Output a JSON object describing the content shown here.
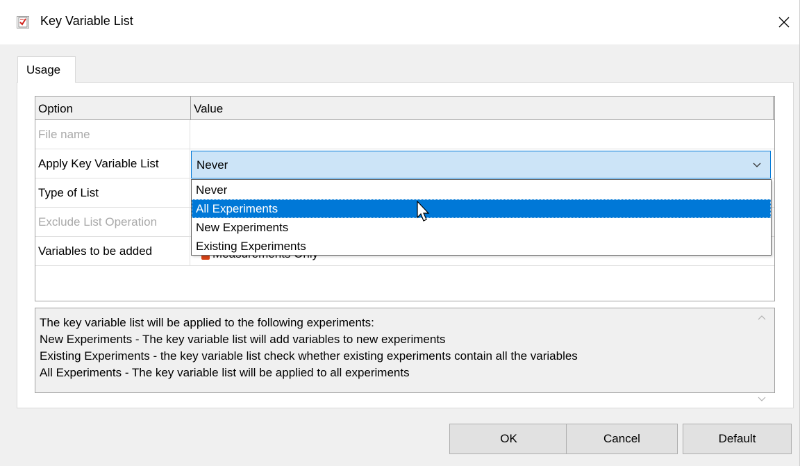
{
  "window": {
    "title": "Key Variable List",
    "close_glyph": "✕"
  },
  "tabs": [
    {
      "label": "Usage",
      "selected": true
    }
  ],
  "grid": {
    "columns": [
      "Option",
      "Value"
    ],
    "rows": [
      {
        "option": "File name",
        "value": "",
        "disabled": true
      },
      {
        "option": "Apply Key Variable List",
        "value": "Never",
        "disabled": false
      },
      {
        "option": "Type of List",
        "value": "",
        "disabled": false
      },
      {
        "option": "Exclude List Operation",
        "value": "",
        "disabled": true
      },
      {
        "option": "Variables to be added",
        "value": "Measurements Only",
        "disabled": false
      }
    ]
  },
  "combo": {
    "selected": "Never",
    "options": [
      "Never",
      "All Experiments",
      "New Experiments",
      "Existing Experiments"
    ],
    "highlighted": "All Experiments"
  },
  "description": {
    "lines": [
      "The key variable list will be applied to the following experiments:",
      "New Experiments - The key variable list will add variables to new experiments",
      "Existing Experiments - the key variable list check whether existing experiments contain all the variables",
      "All Experiments - The key variable list will be applied to all experiments"
    ]
  },
  "buttons": {
    "ok": "OK",
    "cancel": "Cancel",
    "default": "Default"
  },
  "colors": {
    "accent": "#0078d7",
    "combo_bg": "#cce4f7",
    "dialog_bg": "#f0f0f0"
  },
  "icons": {
    "app": "checklist-icon",
    "close": "close-icon",
    "chevron": "chevron-down-icon",
    "cursor": "mouse-pointer-icon"
  }
}
